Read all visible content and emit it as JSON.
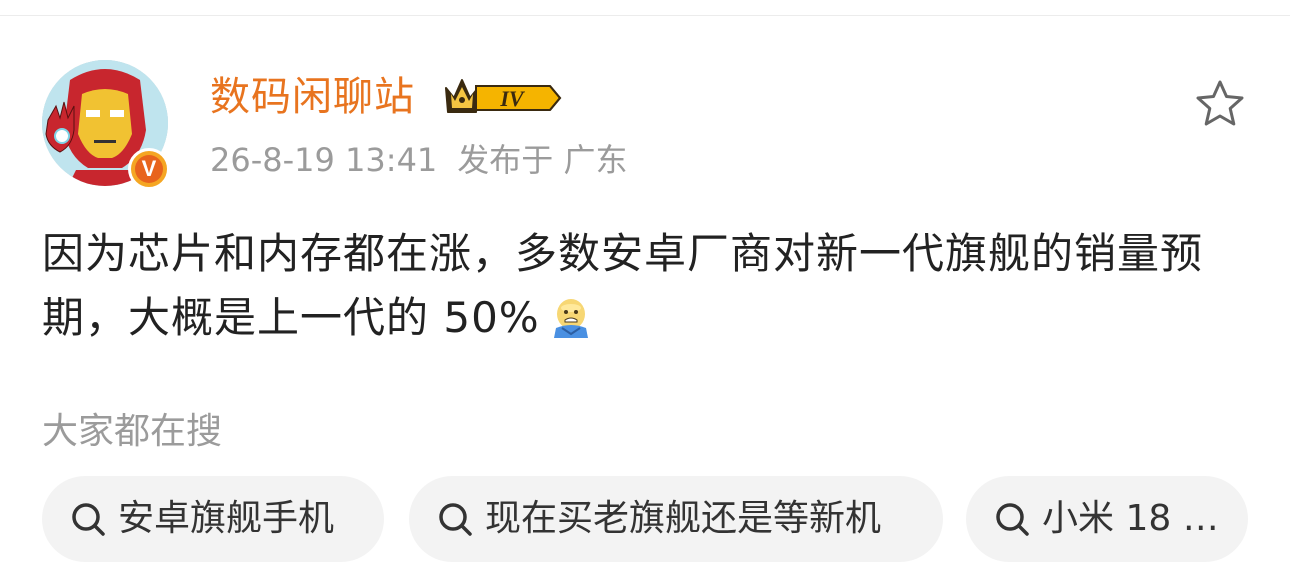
{
  "post": {
    "author": {
      "name": "数码闲聊站",
      "level_badge": "IV",
      "verified_badge": "V"
    },
    "timestamp": "26-8-19 13:41",
    "published_from": "发布于 广东",
    "content": "因为芯片和内存都在涨，多数安卓厂商对新一代旗舰的销量预期，大概是上一代的 50%",
    "emoji": "anxious-sweat-emoji",
    "favorite_icon": "star-outline-icon"
  },
  "search_suggestions": {
    "title": "大家都在搜",
    "items": [
      {
        "label": "安卓旗舰手机",
        "icon": "search-icon"
      },
      {
        "label": "现在买老旗舰还是等新机",
        "icon": "search-icon"
      },
      {
        "label": "小米 18 …",
        "icon": "search-icon"
      }
    ]
  },
  "colors": {
    "username": "#e8741f",
    "meta_text": "#9b9b9b",
    "body_text": "#222222",
    "chip_bg": "#f3f3f3",
    "verified_orange": "#f5a623"
  }
}
